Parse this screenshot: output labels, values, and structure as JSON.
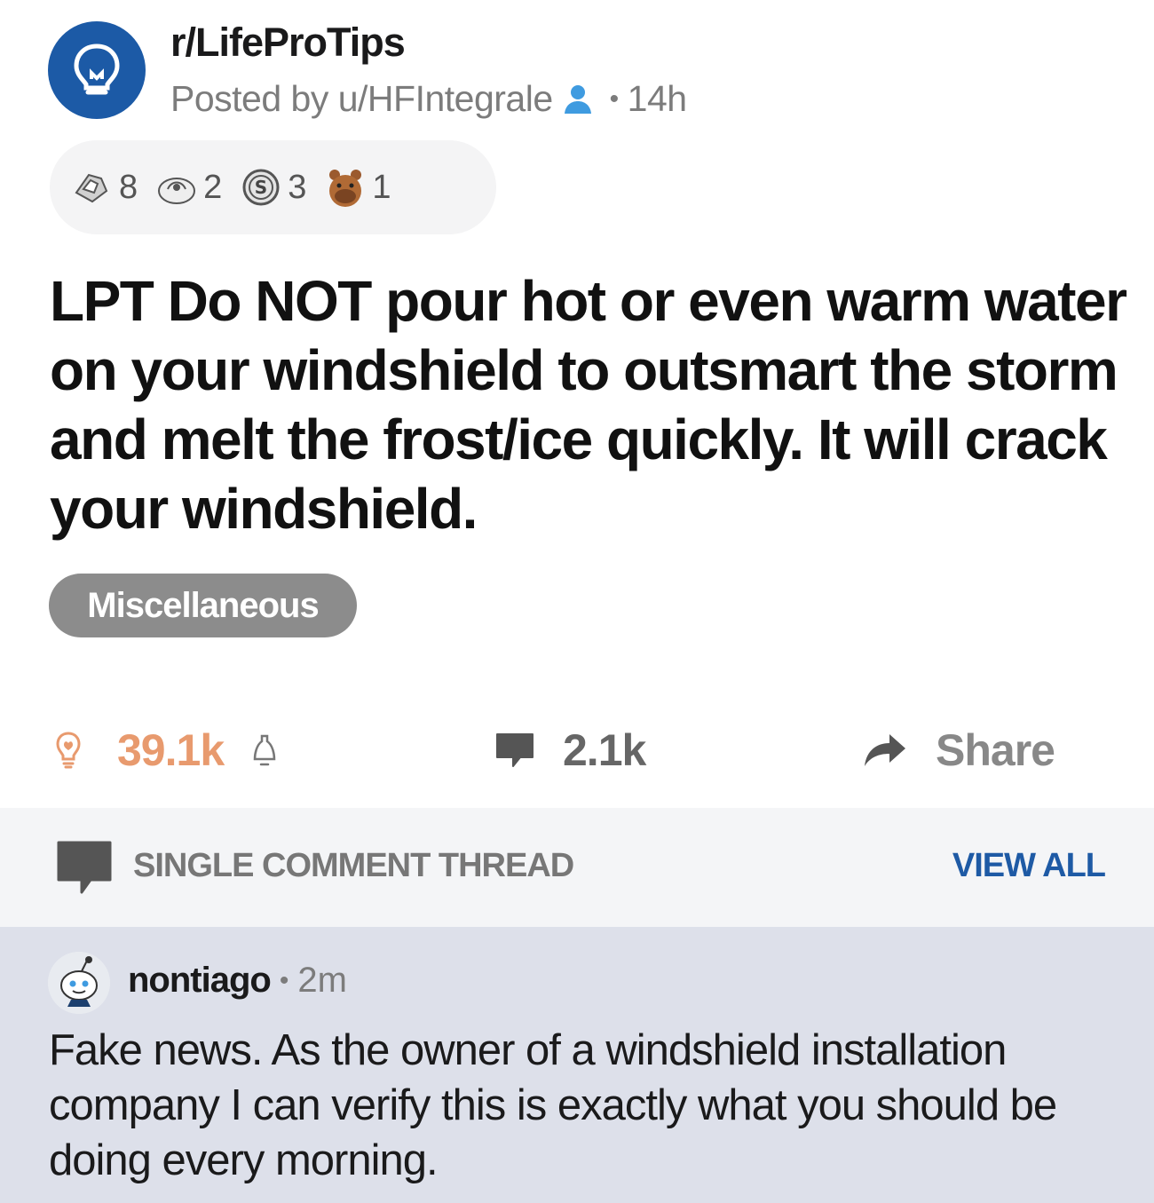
{
  "post": {
    "subreddit": "r/LifeProTips",
    "posted_by": "Posted by u/HFIntegrale",
    "age": "14h",
    "awards": [
      {
        "icon": "silver-award-icon",
        "count": "8"
      },
      {
        "icon": "helpful-award-icon",
        "count": "2"
      },
      {
        "icon": "coin-award-icon",
        "count": "3"
      },
      {
        "icon": "bear-award-icon",
        "count": "1"
      }
    ],
    "title": "LPT Do NOT pour hot or even warm water on your windshield to outsmart the storm and melt the frost/ice quickly. It will crack your windshield.",
    "flair": "Miscellaneous",
    "score": "39.1k",
    "comments_count": "2.1k",
    "share_label": "Share"
  },
  "thread": {
    "title": "SINGLE COMMENT THREAD",
    "view_all": "VIEW ALL"
  },
  "comment": {
    "username": "nontiago",
    "age": "2m",
    "body": "Fake news. As the owner of a windshield installation company I can verify this is exactly what you should be doing every morning."
  },
  "colors": {
    "subreddit_icon_bg": "#1c5aa6",
    "upvote_orange": "#e89a6e",
    "link_blue": "#1e5aa5",
    "flair_bg": "#8c8c8c",
    "thread_bar_bg": "#f4f5f7",
    "comment_bg": "#dde0ea"
  }
}
